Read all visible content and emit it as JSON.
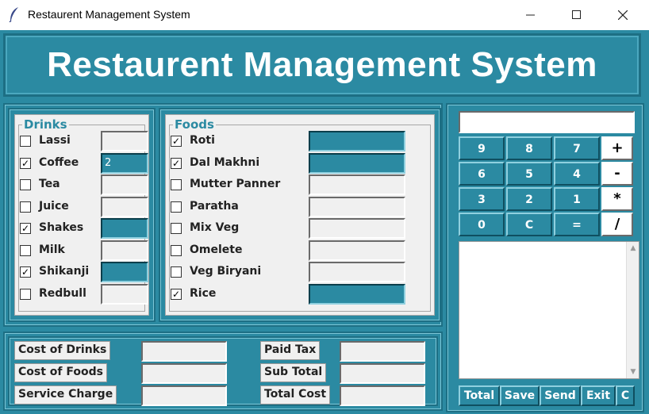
{
  "window": {
    "title": "Restaurent Management System",
    "min_icon": "minimize-icon",
    "max_icon": "maximize-icon",
    "close_icon": "close-icon"
  },
  "header": {
    "title": "Restaurent Management System"
  },
  "drinks": {
    "label": "Drinks",
    "items": [
      {
        "label": "Lassi",
        "checked": false,
        "check_mark": "",
        "qty": ""
      },
      {
        "label": "Coffee",
        "checked": true,
        "check_mark": "✓",
        "qty": "2"
      },
      {
        "label": "Tea",
        "checked": false,
        "check_mark": "",
        "qty": ""
      },
      {
        "label": "Juice",
        "checked": false,
        "check_mark": "",
        "qty": ""
      },
      {
        "label": "Shakes",
        "checked": true,
        "check_mark": "✓",
        "qty": ""
      },
      {
        "label": "Milk",
        "checked": false,
        "check_mark": "",
        "qty": ""
      },
      {
        "label": "Shikanji",
        "checked": true,
        "check_mark": "✓",
        "qty": ""
      },
      {
        "label": "Redbull",
        "checked": false,
        "check_mark": "",
        "qty": ""
      }
    ]
  },
  "foods": {
    "label": "Foods",
    "items": [
      {
        "label": "Roti",
        "checked": true,
        "check_mark": "✓",
        "qty": ""
      },
      {
        "label": "Dal Makhni",
        "checked": true,
        "check_mark": "✓",
        "qty": ""
      },
      {
        "label": "Mutter Panner",
        "checked": false,
        "check_mark": "",
        "qty": ""
      },
      {
        "label": "Paratha",
        "checked": false,
        "check_mark": "",
        "qty": ""
      },
      {
        "label": "Mix Veg",
        "checked": false,
        "check_mark": "",
        "qty": ""
      },
      {
        "label": "Omelete",
        "checked": false,
        "check_mark": "",
        "qty": ""
      },
      {
        "label": "Veg Biryani",
        "checked": false,
        "check_mark": "",
        "qty": ""
      },
      {
        "label": "Rice",
        "checked": true,
        "check_mark": "✓",
        "qty": ""
      }
    ]
  },
  "costs": {
    "cost_of_drinks": {
      "label": "Cost of Drinks",
      "value": ""
    },
    "cost_of_foods": {
      "label": "Cost of Foods",
      "value": ""
    },
    "service_charge": {
      "label": "Service Charge",
      "value": ""
    },
    "paid_tax": {
      "label": "Paid Tax",
      "value": ""
    },
    "sub_total": {
      "label": "Sub Total",
      "value": ""
    },
    "total_cost": {
      "label": "Total Cost",
      "value": ""
    }
  },
  "calculator": {
    "display": "",
    "keys": [
      [
        "9",
        "8",
        "7",
        "+"
      ],
      [
        "6",
        "5",
        "4",
        "-"
      ],
      [
        "3",
        "2",
        "1",
        "*"
      ],
      [
        "0",
        "C",
        "=",
        "/"
      ]
    ]
  },
  "receipt": {
    "text": ""
  },
  "bottom_buttons": {
    "total": "Total",
    "save": "Save",
    "send": "Send",
    "exit": "Exit",
    "clear": "C"
  },
  "colors": {
    "teal": "#2b8aa2",
    "panel": "#f0f0f0",
    "group_label": "#2b8aa2"
  }
}
